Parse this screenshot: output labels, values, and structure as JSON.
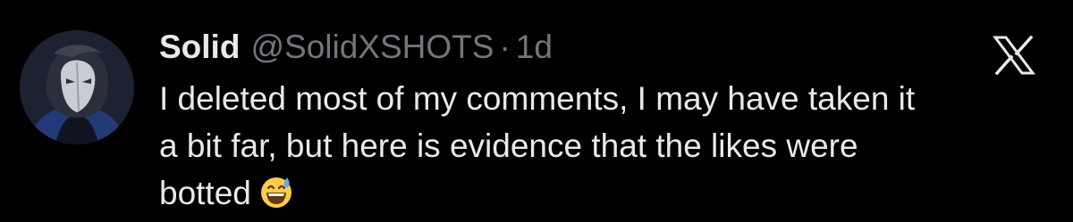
{
  "tweet": {
    "author": {
      "display_name": "Solid",
      "handle": "@SolidXSHOTS",
      "avatar_icon": "hooded-masked-character-avatar"
    },
    "separator": "·",
    "time_ago": "1d",
    "platform_icon": "x-logo-icon",
    "text_lines": [
      "I deleted most of my comments, I may have taken it",
      "a bit far, but here is evidence that the likes were",
      "botted"
    ],
    "trailing_emoji": "grinning-face-with-sweat-emoji"
  },
  "colors": {
    "background": "#000000",
    "primary_text": "#e7e9ea",
    "secondary_text": "#71767b",
    "emoji_yellow": "#ffcb4c",
    "sweat_blue": "#5dadec"
  }
}
